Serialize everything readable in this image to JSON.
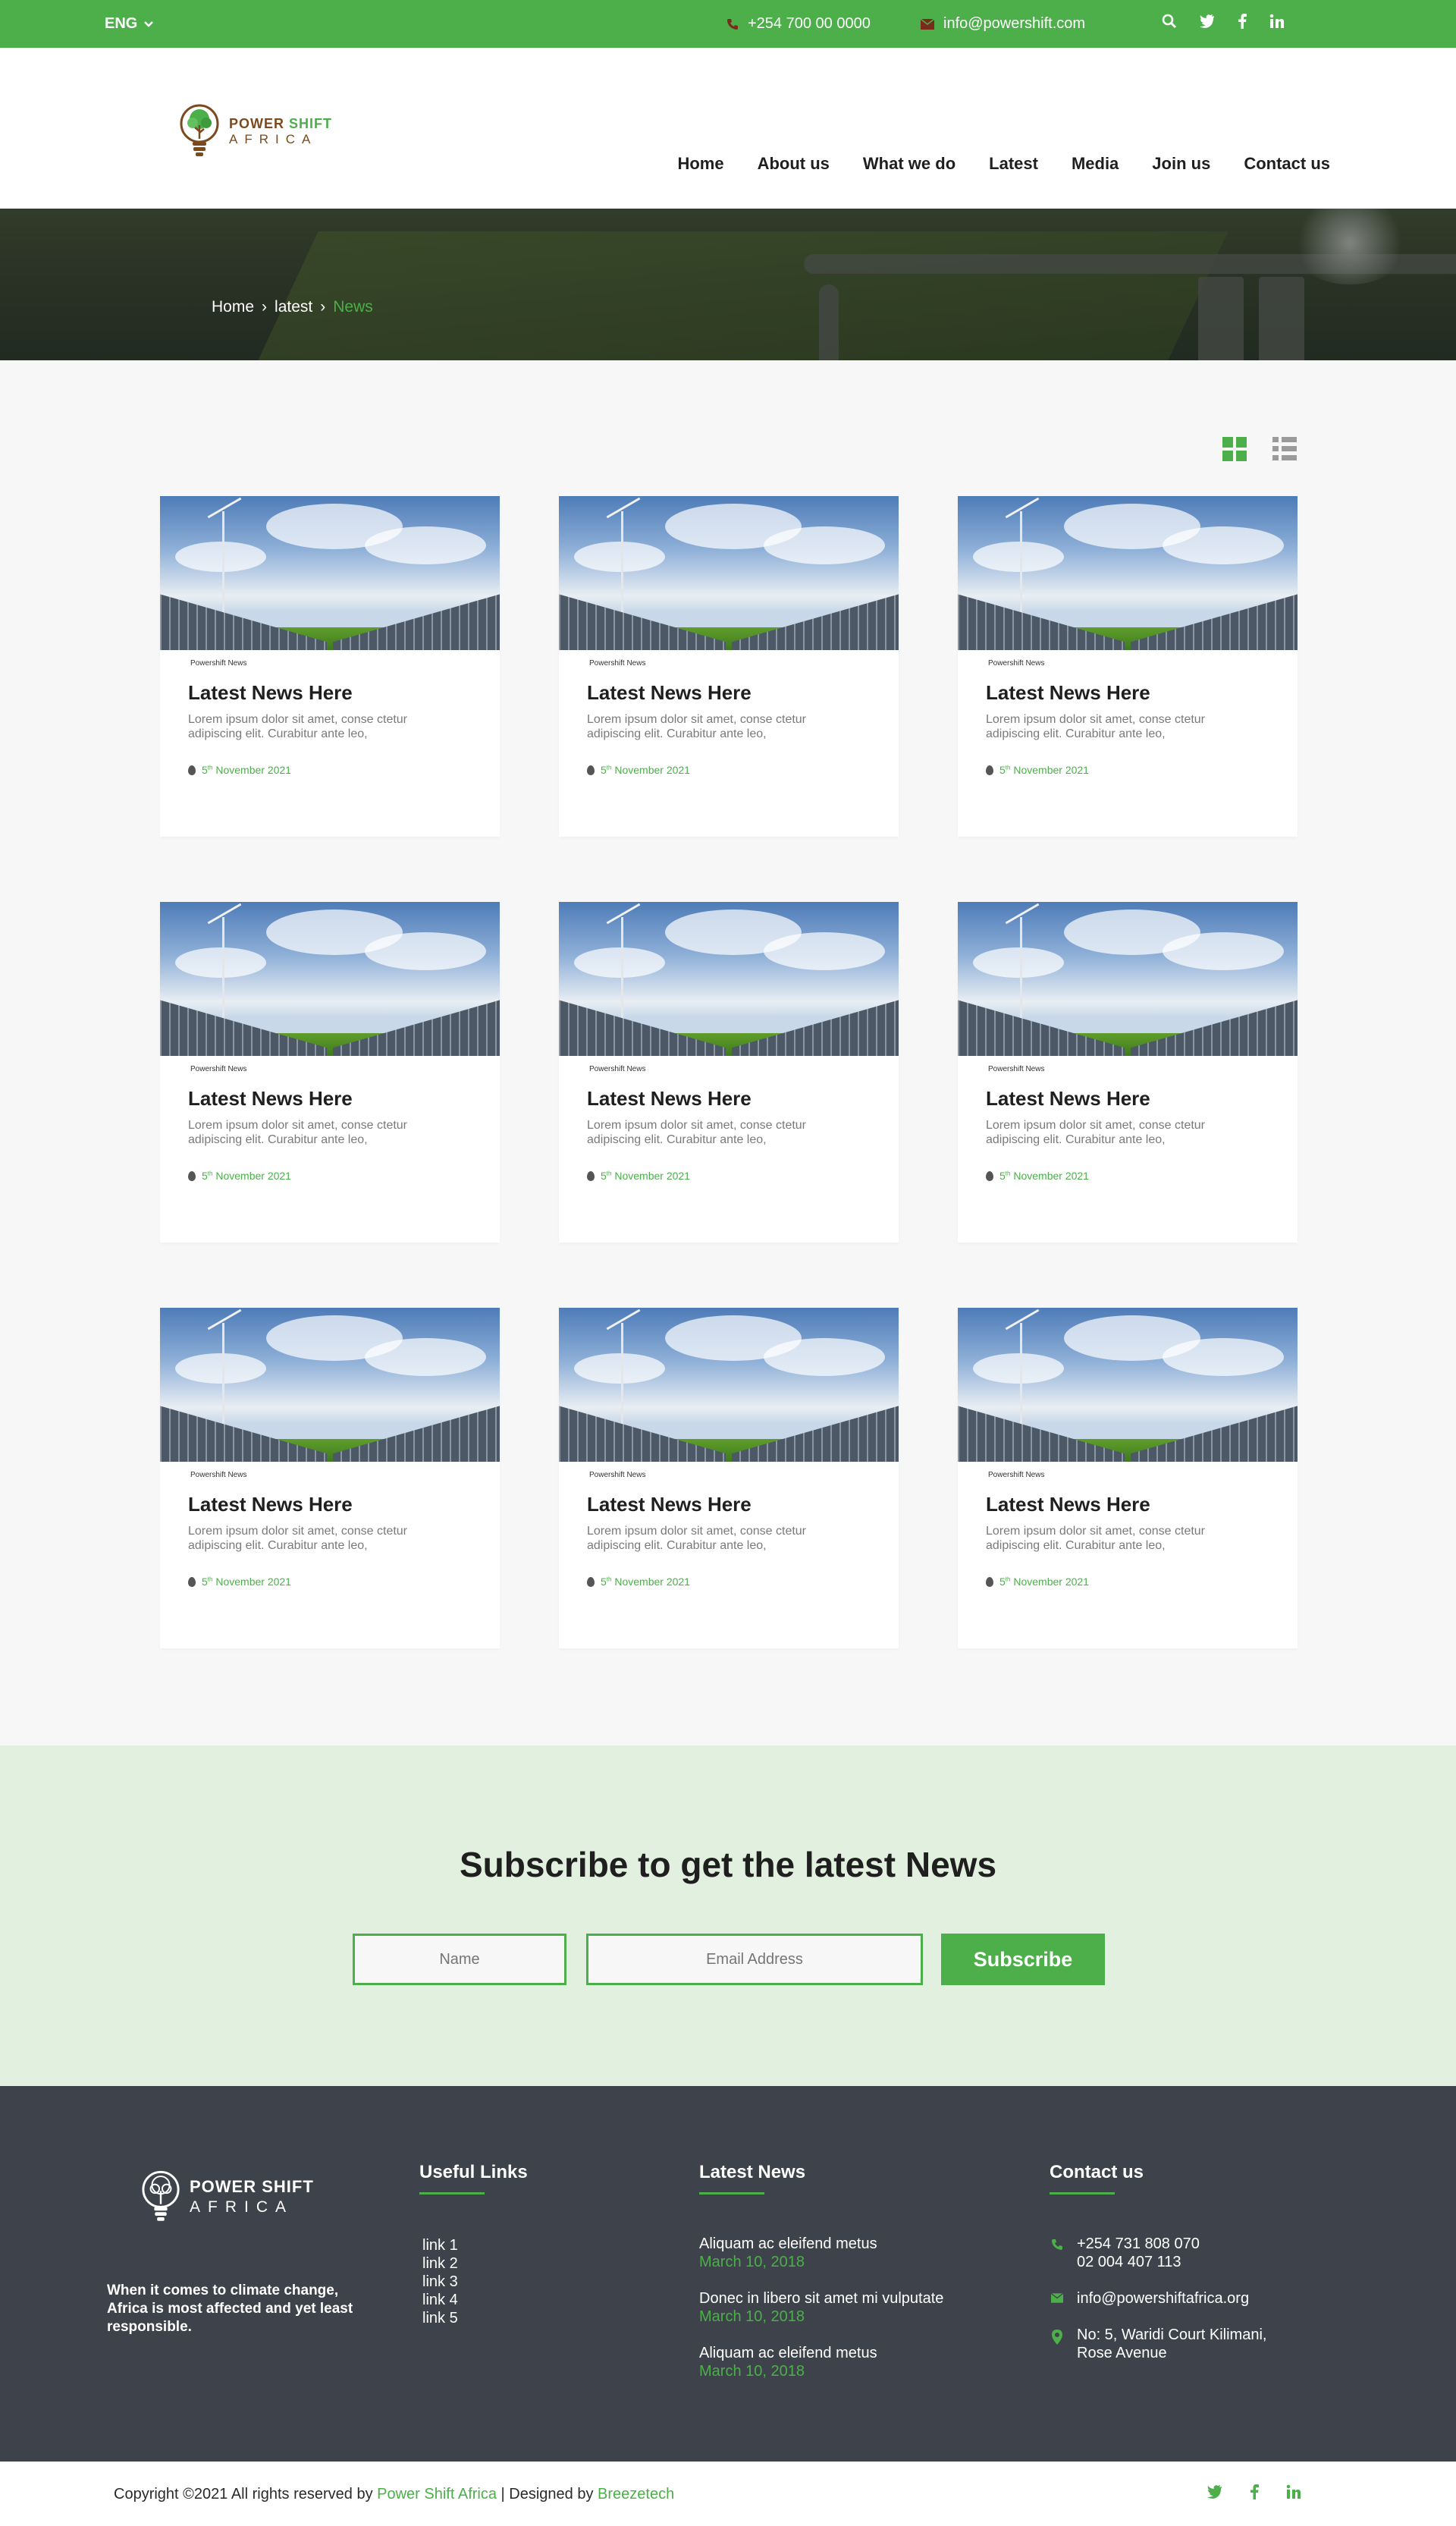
{
  "topbar": {
    "language": "ENG",
    "phone": "+254 700 00 0000",
    "email": "info@powershift.com",
    "icons": [
      "search-icon",
      "twitter-icon",
      "facebook-icon",
      "linkedin-icon"
    ]
  },
  "header": {
    "logo_line1_a": "POWER",
    "logo_line1_b": "SHIFT",
    "logo_line2": "AFRICA",
    "nav": [
      "Home",
      "About us",
      "What we do",
      "Latest",
      "Media",
      "Join us",
      "Contact us"
    ]
  },
  "breadcrumb": {
    "items": [
      "Home",
      "latest"
    ],
    "current": "News",
    "separator": "›"
  },
  "view_toggle": {
    "grid": "grid-view-icon",
    "list": "list-view-icon"
  },
  "cards": [
    {
      "tag": "Powershift News",
      "title": "Latest News Here",
      "excerpt": "Lorem ipsum dolor sit amet, conse ctetur adipiscing elit. Curabitur ante leo,",
      "date_day": "5",
      "date_suffix": "th",
      "date_rest": " November 2021"
    },
    {
      "tag": "Powershift News",
      "title": "Latest News Here",
      "excerpt": "Lorem ipsum dolor sit amet, conse ctetur adipiscing elit. Curabitur ante leo,",
      "date_day": "5",
      "date_suffix": "th",
      "date_rest": " November 2021"
    },
    {
      "tag": "Powershift News",
      "title": "Latest News Here",
      "excerpt": "Lorem ipsum dolor sit amet, conse ctetur adipiscing elit. Curabitur ante leo,",
      "date_day": "5",
      "date_suffix": "th",
      "date_rest": " November 2021"
    },
    {
      "tag": "Powershift News",
      "title": "Latest News Here",
      "excerpt": "Lorem ipsum dolor sit amet, conse ctetur adipiscing elit. Curabitur ante leo,",
      "date_day": "5",
      "date_suffix": "th",
      "date_rest": " November 2021"
    },
    {
      "tag": "Powershift News",
      "title": "Latest News Here",
      "excerpt": "Lorem ipsum dolor sit amet, conse ctetur adipiscing elit. Curabitur ante leo,",
      "date_day": "5",
      "date_suffix": "th",
      "date_rest": " November 2021"
    },
    {
      "tag": "Powershift News",
      "title": "Latest News Here",
      "excerpt": "Lorem ipsum dolor sit amet, conse ctetur adipiscing elit. Curabitur ante leo,",
      "date_day": "5",
      "date_suffix": "th",
      "date_rest": " November 2021"
    },
    {
      "tag": "Powershift News",
      "title": "Latest News Here",
      "excerpt": "Lorem ipsum dolor sit amet, conse ctetur adipiscing elit. Curabitur ante leo,",
      "date_day": "5",
      "date_suffix": "th",
      "date_rest": " November 2021"
    },
    {
      "tag": "Powershift News",
      "title": "Latest News Here",
      "excerpt": "Lorem ipsum dolor sit amet, conse ctetur adipiscing elit. Curabitur ante leo,",
      "date_day": "5",
      "date_suffix": "th",
      "date_rest": " November 2021"
    },
    {
      "tag": "Powershift News",
      "title": "Latest News Here",
      "excerpt": "Lorem ipsum dolor sit amet, conse ctetur adipiscing elit. Curabitur ante leo,",
      "date_day": "5",
      "date_suffix": "th",
      "date_rest": " November 2021"
    }
  ],
  "subscribe": {
    "title": "Subscribe to get the latest News",
    "name_placeholder": "Name",
    "email_placeholder": "Email Address",
    "button": "Subscribe"
  },
  "footer": {
    "logo_line1": "POWER SHIFT",
    "logo_line2": "AFRICA",
    "about": "When it comes to climate change, Africa is most affected and yet least responsible.",
    "links_title": "Useful Links",
    "links": [
      "link 1",
      "link 2",
      "link 3",
      "link 4",
      "link 5"
    ],
    "news_title": "Latest News",
    "news": [
      {
        "title": "Aliquam ac eleifend metus",
        "date": "March 10, 2018"
      },
      {
        "title": "Donec in libero sit amet mi vulputate",
        "date": "March 10, 2018"
      },
      {
        "title": "Aliquam ac eleifend metus",
        "date": "March 10, 2018"
      }
    ],
    "contact_title": "Contact us",
    "phone1": "+254 731 808 070",
    "phone2": "02 004 407 113",
    "email": "info@powershiftafrica.org",
    "address1": "No: 5, Waridi Court Kilimani,",
    "address2": "Rose Avenue"
  },
  "bottom": {
    "copy_prefix": "Copyright ©2021 All rights reserved by ",
    "org": "Power Shift Africa",
    "mid": " | Designed by ",
    "designer": "Breezetech",
    "icons": [
      "twitter-icon",
      "facebook-icon",
      "linkedin-icon"
    ]
  },
  "colors": {
    "accent": "#4caf4a",
    "footer_bg": "#3e424a",
    "subscribe_bg": "#e2f0df"
  }
}
